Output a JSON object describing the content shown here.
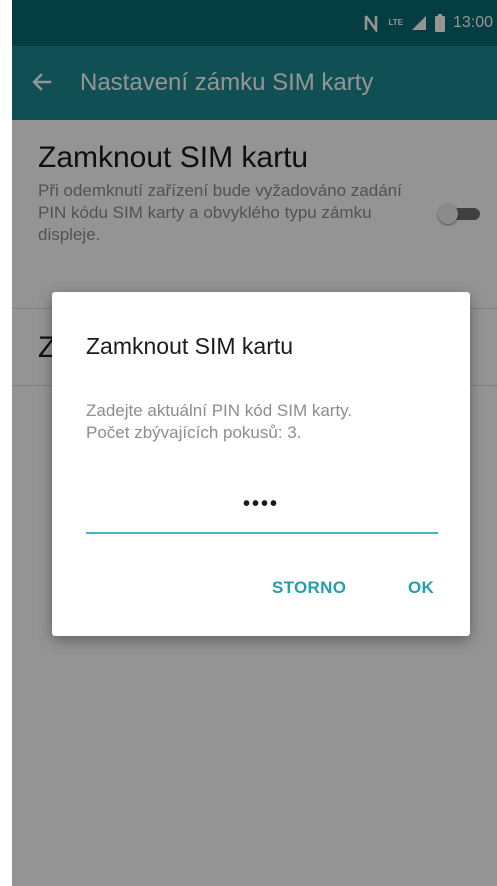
{
  "status_bar": {
    "time": "13:00",
    "network_label": "LTE",
    "icons": [
      "nfc-icon",
      "lte-icon",
      "signal-icon",
      "battery-icon"
    ]
  },
  "app_bar": {
    "title": "Nastavení zámku SIM karty",
    "back_icon": "arrow-left-icon"
  },
  "preference": {
    "title": "Zamknout SIM kartu",
    "summary": "Při odemknutí zařízení bude vyžadováno zadání PIN kódu SIM karty a obvyklého typu zámku displeje.",
    "toggle_state": "off"
  },
  "preference2": {
    "title_partial": "Z"
  },
  "dialog": {
    "title": "Zamknout SIM kartu",
    "message_line1": "Zadejte aktuální PIN kód SIM karty.",
    "message_line2": "Počet zbývajících pokusů: 3.",
    "pin_value": "••••",
    "cancel_label": "STORNO",
    "ok_label": "OK"
  },
  "colors": {
    "status_bar": "#0a6b73",
    "app_bar": "#1d8b93",
    "accent": "#22a0ab",
    "input_underline": "#43b8c2"
  }
}
